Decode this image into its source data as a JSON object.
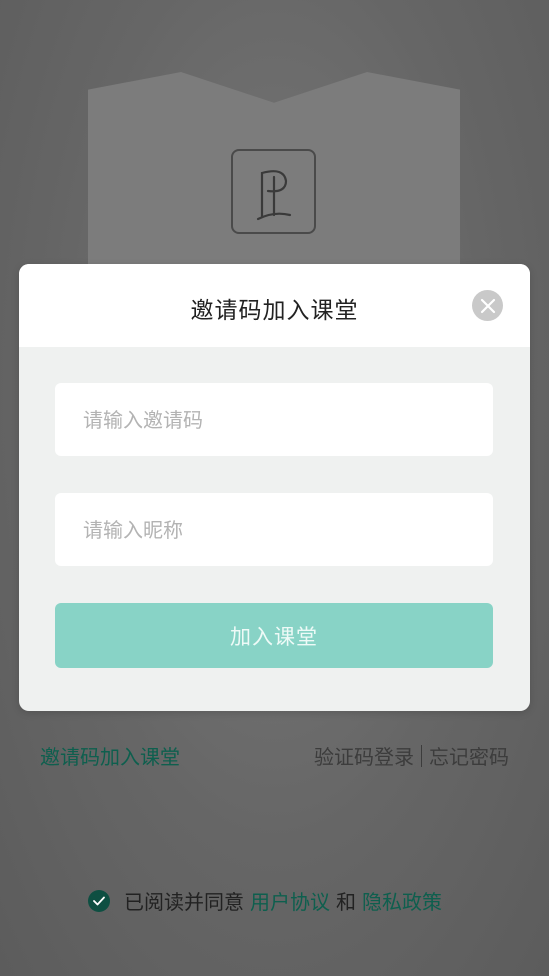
{
  "modal": {
    "title": "邀请码加入课堂",
    "invite_placeholder": "请输入邀请码",
    "nickname_placeholder": "请输入昵称",
    "join_button": "加入课堂"
  },
  "links": {
    "invite_join": "邀请码加入课堂",
    "sms_login": "验证码登录",
    "forgot_password": "忘记密码"
  },
  "agreement": {
    "prefix": "已阅读并同意",
    "user_agreement": "用户协议",
    "and": "和",
    "privacy_policy": "隐私政策"
  },
  "icons": {
    "logo": "pen-p-logo-icon",
    "close": "close-icon",
    "check": "check-circle-icon"
  },
  "colors": {
    "accent": "#88d3c6",
    "link_green": "#0e5f4e",
    "check_fill": "#0e4f42"
  }
}
